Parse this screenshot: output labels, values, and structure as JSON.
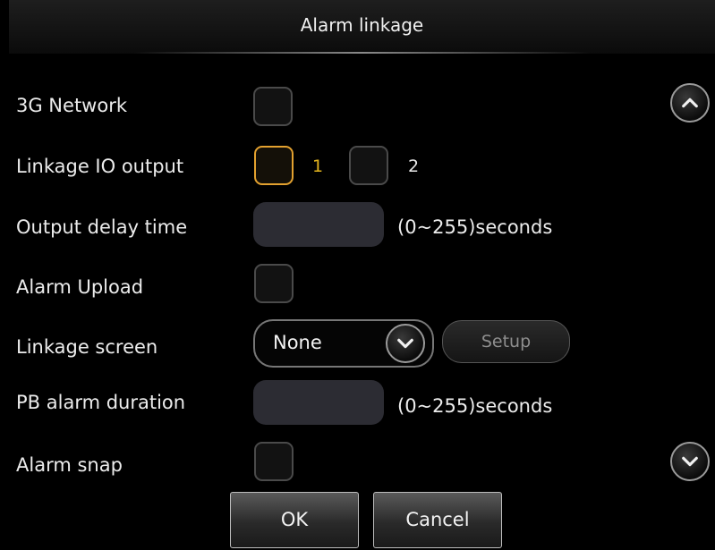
{
  "window": {
    "title": "Alarm linkage"
  },
  "rows": {
    "network_3g": {
      "label": "3G Network",
      "checked": false
    },
    "linkage_io": {
      "label": "Linkage IO output",
      "options": [
        {
          "label": "1",
          "checked": false,
          "focused": true
        },
        {
          "label": "2",
          "checked": false
        }
      ]
    },
    "output_delay": {
      "label": "Output delay time",
      "value": "",
      "unit": "(0~255)seconds"
    },
    "alarm_upload": {
      "label": "Alarm Upload",
      "checked": false
    },
    "linkage_screen": {
      "label": "Linkage screen",
      "selected": "None",
      "setup_label": "Setup"
    },
    "pb_alarm": {
      "label": "PB alarm duration",
      "value": "",
      "unit": "(0~255)seconds"
    },
    "alarm_snap": {
      "label": "Alarm snap",
      "checked": false
    }
  },
  "buttons": {
    "ok": "OK",
    "cancel": "Cancel"
  },
  "icons": {
    "scroll_up": "chevron-up-icon",
    "scroll_down": "chevron-down-icon",
    "dropdown": "chevron-down-icon"
  },
  "colors": {
    "focus": "#e3a12f",
    "background": "#000000",
    "field": "#2c2c33"
  }
}
